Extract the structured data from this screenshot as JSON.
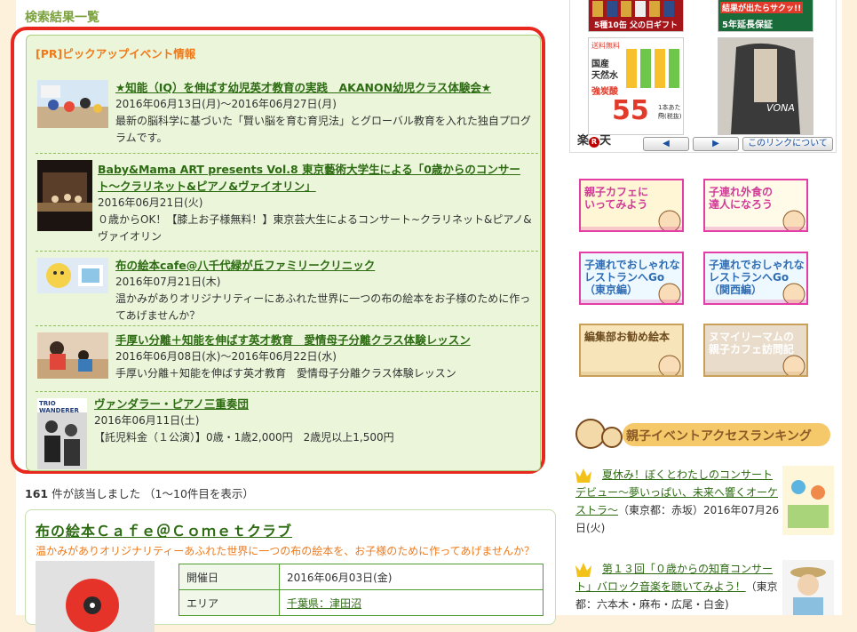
{
  "section_title": "検索結果一覧",
  "pickup": {
    "heading": "[PR]ピックアップイベント情報",
    "items": [
      {
        "title": "★知能（IQ）を伸ばす幼児英才教育の実践　AKANON幼児クラス体験会★",
        "date": "2016年06月13日(月)〜2016年06月27日(月)",
        "desc": "最新の脳科学に基づいた「賢い脳を育む育児法」とグローバル教育を入れた独自プログラムです。"
      },
      {
        "title": "Baby&Mama ART presents Vol.8 東京藝術大学生による「0歳からのコンサート〜クラリネット&ピアノ&ヴァイオリン」",
        "date": "2016年06月21日(火)",
        "desc": "０歳からOK！【膝上お子様無料！】東京芸大生によるコンサート~クラリネット&ピアノ&ヴァイオリン"
      },
      {
        "title": "布の絵本cafe@八千代緑が丘ファミリークリニック",
        "date": "2016年07月21日(木)",
        "desc": "温かみがありオリジナリティーにあふれた世界に一つの布の絵本をお子様のために作ってあげませんか？"
      },
      {
        "title": "手厚い分離＋知能を伸ばす英才教育　愛情母子分離クラス体験レッスン",
        "date": "2016年06月08日(水)〜2016年06月22日(水)",
        "desc": "手厚い分離＋知能を伸ばす英才教育　愛情母子分離クラス体験レッスン"
      },
      {
        "title": "ヴァンダラー・ピアノ三重奏団",
        "date": "2016年06月11日(土)",
        "desc": "【託児料金（１公演）】0歳・1歳2,000円　2歳児以上1,500円",
        "thumb_text": "TRIO WANDERER"
      }
    ]
  },
  "result_count": {
    "count": "161",
    "text": " 件が該当しました （1〜10件目を表示）"
  },
  "event": {
    "title": "布の絵本Ｃａｆｅ＠Ｃｏｍｅｔクラブ",
    "subtitle": "温かみがありオリジナリティーあふれた世界に一つの布の絵本を、お子様のために作ってあげませんか？",
    "rows": [
      {
        "label": "開催日",
        "value": "2016年06月03日(金)"
      },
      {
        "label": "エリア",
        "value": "千葉県：津田沼"
      }
    ]
  },
  "rakuten": {
    "ad1_text": "5種10缶 父の日ギフト",
    "ad2_line1": "結果が出たらサクッ!!",
    "ad2_line2": "5年延長保証",
    "ad3_lines": [
      "送料無料",
      "国産",
      "天然水",
      "強炭酸",
      "55",
      "1本あたり",
      "円(税抜)"
    ],
    "ad4_text": "VONA",
    "logo_text": "楽",
    "logo_mark": "R",
    "logo_text2": "天",
    "prev": "◀",
    "next": "▶",
    "about": "このリンクについて"
  },
  "banners": [
    {
      "text": "親子カフェに\nいってみよう",
      "colors": {
        "border": "#e33da6",
        "bg": "#fff6d6",
        "fg": "#d23a98"
      }
    },
    {
      "text": "子連れ外食の\n達人になろう",
      "colors": {
        "border": "#e33da6",
        "bg": "#fffbe8",
        "fg": "#d23a98"
      }
    },
    {
      "text": "子連れでおしゃれな\nレストランへGo\n（東京編）",
      "colors": {
        "border": "#e33da6",
        "bg": "#eef9ff",
        "fg": "#2e6cb5"
      }
    },
    {
      "text": "子連れでおしゃれな\nレストランへGo\n（関西編）",
      "colors": {
        "border": "#e33da6",
        "bg": "#eef9ff",
        "fg": "#2e6cb5"
      }
    },
    {
      "text": "編集部お勧め絵本",
      "colors": {
        "border": "#c9a05a",
        "bg": "#f7e4b8",
        "fg": "#6b4a1e"
      }
    },
    {
      "text": "ヌマイリーマムの\n親子カフェ訪問記",
      "colors": {
        "border": "#c9a05a",
        "bg": "#e9dccb",
        "fg": "#ffffff"
      }
    }
  ],
  "ranking": {
    "title": "親子イベントアクセスランキング",
    "items": [
      {
        "rank": "1",
        "title": "夏休み！ぼくとわたしのコンサートデビュー〜夢いっぱい、未来へ響くオーケストラ〜",
        "meta": "（東京都：赤坂）2016年07月26日(火)"
      },
      {
        "rank": "2",
        "title": "第１３回「０歳からの知育コンサート」バロック音楽を聴いてみよう！",
        "meta": "（東京都：六本木・麻布・広尾・白金)"
      }
    ]
  }
}
